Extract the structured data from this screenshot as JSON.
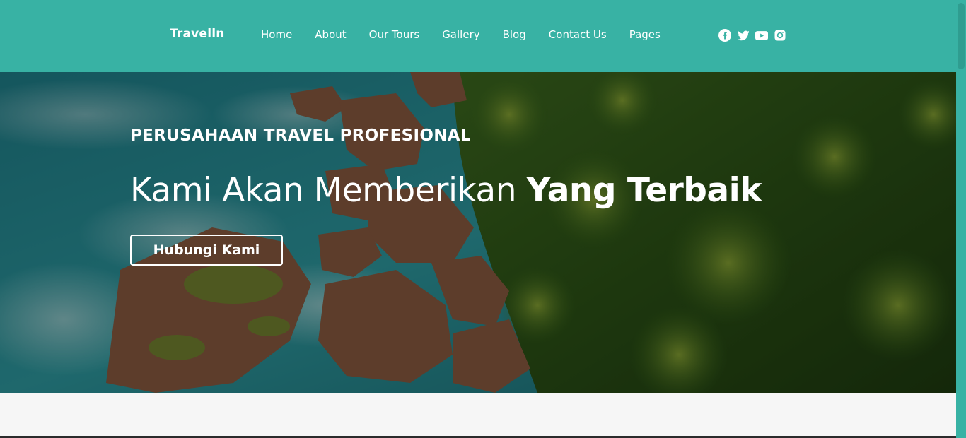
{
  "navbar": {
    "brand": "Travelln",
    "links": [
      "Home",
      "About",
      "Our Tours",
      "Gallery",
      "Blog",
      "Contact Us",
      "Pages"
    ],
    "socials": [
      "facebook-icon",
      "twitter-icon",
      "youtube-icon",
      "instagram-icon"
    ],
    "bg_color": "#38b2a4"
  },
  "hero": {
    "eyebrow": "PERUSAHAAN TRAVEL PROFESIONAL",
    "title_light": "Kami Akan Memberikan ",
    "title_bold": "Yang Terbaik",
    "button_label": "Hubungi Kami"
  },
  "colors": {
    "accent": "#38b2a4",
    "text_on_accent": "#ffffff",
    "page_bg": "#f6f6f6"
  }
}
